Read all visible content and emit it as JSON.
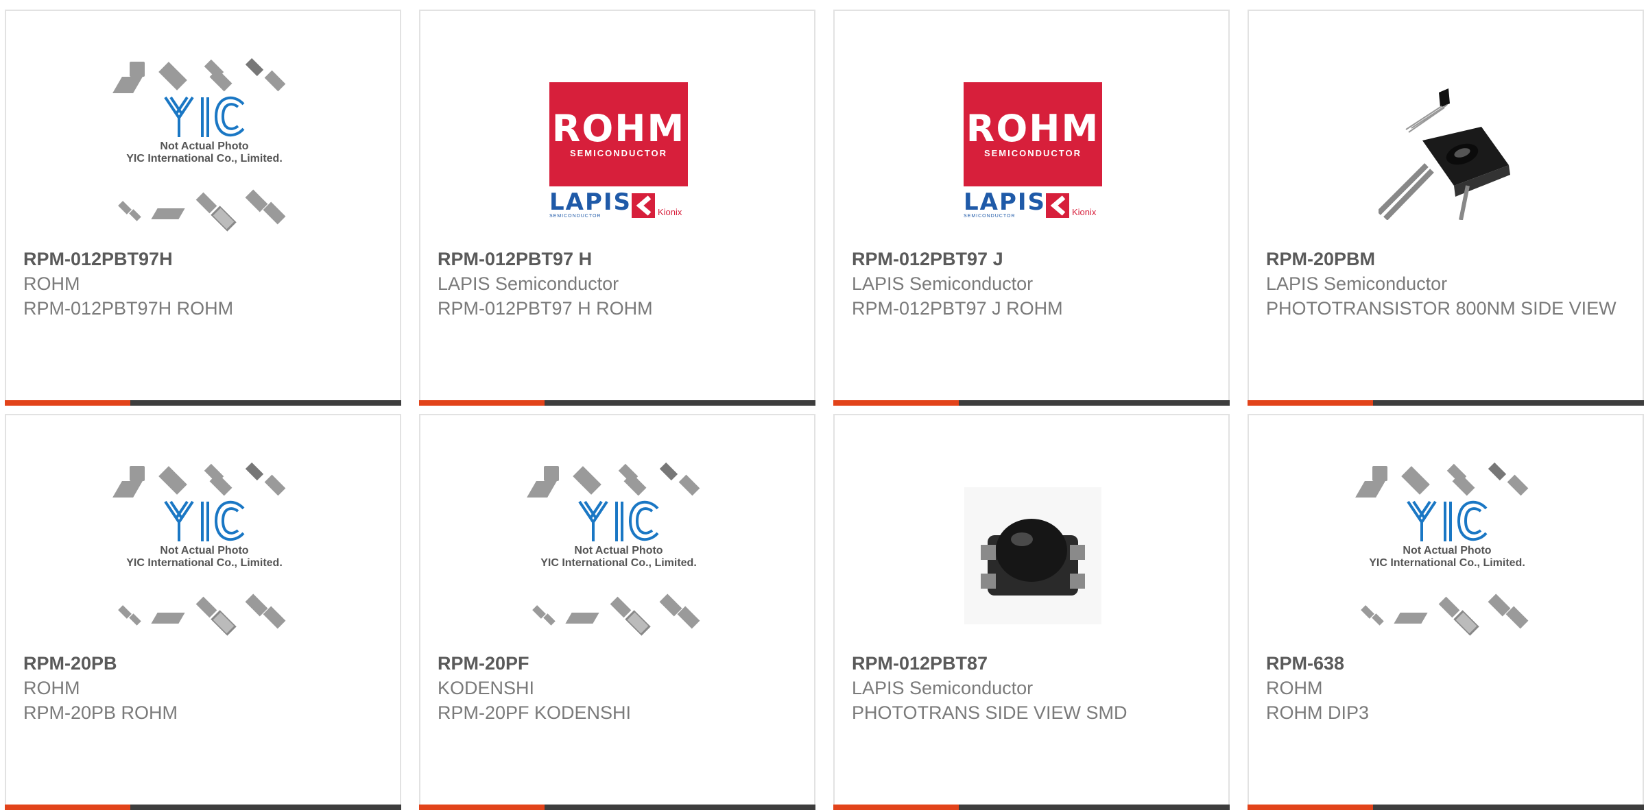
{
  "colors": {
    "accent": "#e2431a",
    "bar": "#3d3d3d",
    "border": "#e2e2e2",
    "logo_red": "#d71f3b",
    "yic_blue": "#1a77c4"
  },
  "placeholder": {
    "brand": "YIC",
    "line1": "Not Actual Photo",
    "line2": "YIC International Co., Limited."
  },
  "logo": {
    "rohm": "ROHM",
    "semiconductor": "SEMICONDUCTOR",
    "lapis": "LAPIS",
    "lapis_sub": "SEMICONDUCTOR",
    "kionix": "Kionix"
  },
  "products": [
    {
      "part": "RPM-012PBT97H",
      "manufacturer": "ROHM",
      "description": "RPM-012PBT97H ROHM",
      "image": "placeholder"
    },
    {
      "part": "RPM-012PBT97 H",
      "manufacturer": "LAPIS Semiconductor",
      "description": "RPM-012PBT97 H ROHM",
      "image": "logo"
    },
    {
      "part": "RPM-012PBT97 J",
      "manufacturer": "LAPIS Semiconductor",
      "description": "RPM-012PBT97 J ROHM",
      "image": "logo"
    },
    {
      "part": "RPM-20PBM",
      "manufacturer": "LAPIS Semiconductor",
      "description": "PHOTOTRANSISTOR 800NM SIDE VIEW",
      "image": "phototransistor-photo"
    },
    {
      "part": "RPM-20PB",
      "manufacturer": "ROHM",
      "description": "RPM-20PB ROHM",
      "image": "placeholder"
    },
    {
      "part": "RPM-20PF",
      "manufacturer": "KODENSHI",
      "description": "RPM-20PF KODENSHI",
      "image": "placeholder"
    },
    {
      "part": "RPM-012PBT87",
      "manufacturer": "LAPIS Semiconductor",
      "description": "PHOTOTRANS SIDE VIEW SMD",
      "image": "smd-photo"
    },
    {
      "part": "RPM-638",
      "manufacturer": "ROHM",
      "description": "ROHM DIP3",
      "image": "placeholder"
    }
  ]
}
